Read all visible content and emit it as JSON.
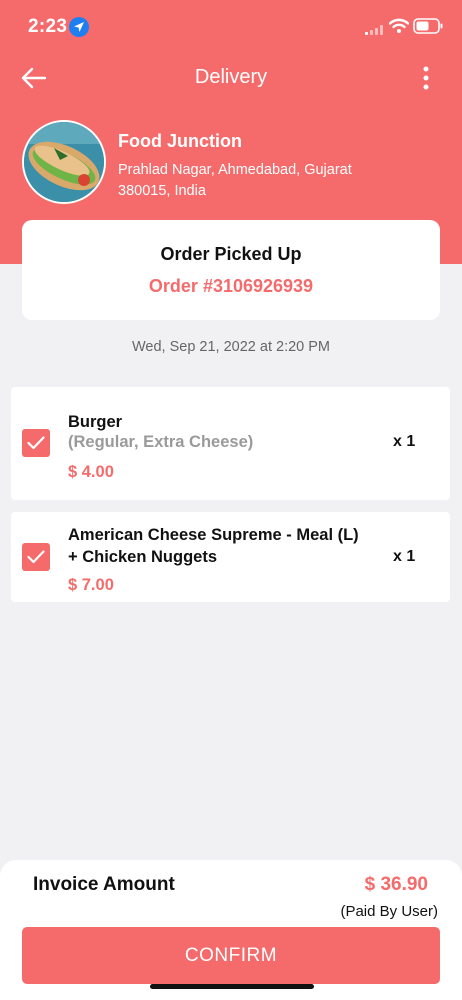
{
  "status_bar": {
    "time": "2:23",
    "icons": [
      "location-arrow-icon",
      "cellular-signal-icon",
      "wifi-icon",
      "battery-icon"
    ]
  },
  "nav": {
    "title": "Delivery",
    "back_icon": "arrow-left-icon",
    "more_icon": "more-vertical-icon"
  },
  "restaurant": {
    "name": "Food Junction",
    "address": "Prahlad Nagar, Ahmedabad, Gujarat 380015, India"
  },
  "order": {
    "status": "Order Picked Up",
    "number": "Order #3106926939",
    "date": "Wed, Sep 21, 2022 at 2:20 PM"
  },
  "items": [
    {
      "name": "Burger",
      "options": "(Regular, Extra Cheese)",
      "price": "$ 4.00",
      "quantity": "x 1",
      "checked": true
    },
    {
      "name": "American Cheese Supreme -  Meal (L) + Chicken Nuggets",
      "options": "",
      "price": "$ 7.00",
      "quantity": "x 1",
      "checked": true
    }
  ],
  "footer": {
    "invoice_label": "Invoice Amount",
    "invoice_amount": "$ 36.90",
    "paid_by": "(Paid By User)",
    "confirm_label": "CONFIRM"
  },
  "colors": {
    "accent": "#f56b6b",
    "background": "#f1f1f4",
    "card": "#ffffff",
    "muted_text": "#9a9a9a"
  }
}
